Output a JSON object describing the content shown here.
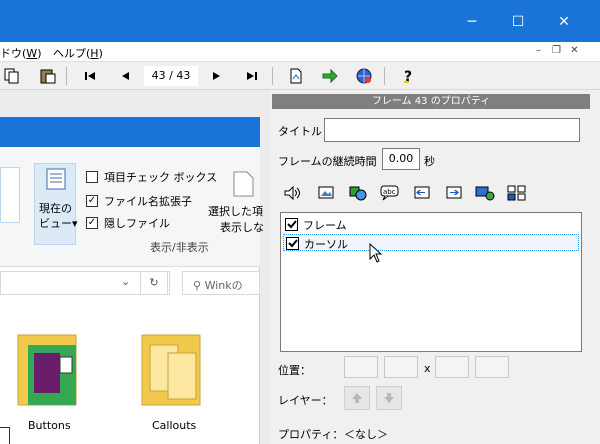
{
  "window": {
    "minimize": "─",
    "maximize": "☐",
    "close": "✕"
  },
  "menu": {
    "window_label": "ウインドウ(W)",
    "window_visible": "ドウ(",
    "window_key": "W",
    "help_label": "ヘルプ(",
    "help_key": "H",
    "close_paren": ")"
  },
  "toolbar": {
    "frame_counter": "43 / 43"
  },
  "explorer": {
    "current_view_line1": "現在の",
    "current_view_line2": "ビュー▾",
    "item_checkbox": "項目チェック ボックス",
    "file_ext": "ファイル名拡張子",
    "hidden_files": "隠しファイル",
    "group_label": "表示/非表示",
    "selected_line1": "選択した項",
    "selected_line2": "表示しな",
    "search_placeholder": "Winkの",
    "folder1": "Buttons",
    "folder2": "Callouts"
  },
  "panel": {
    "header": "フレーム 43 のプロパティ",
    "title_label": "タイトル",
    "title_value": "",
    "duration_label": "フレームの継続時間",
    "duration_value": "0.00",
    "duration_unit": "秒",
    "items": [
      {
        "label": "フレーム",
        "checked": true
      },
      {
        "label": "カーソル",
        "checked": true
      }
    ],
    "position_label": "位置：",
    "position_x": "x",
    "layer_label": "レイヤー：",
    "property_label": "プロパティ：",
    "property_value": "＜なし＞"
  },
  "colors": {
    "titlebar": "#1a73d9",
    "panel_header": "#7f7f7f",
    "selection_border": "#3399ff"
  }
}
